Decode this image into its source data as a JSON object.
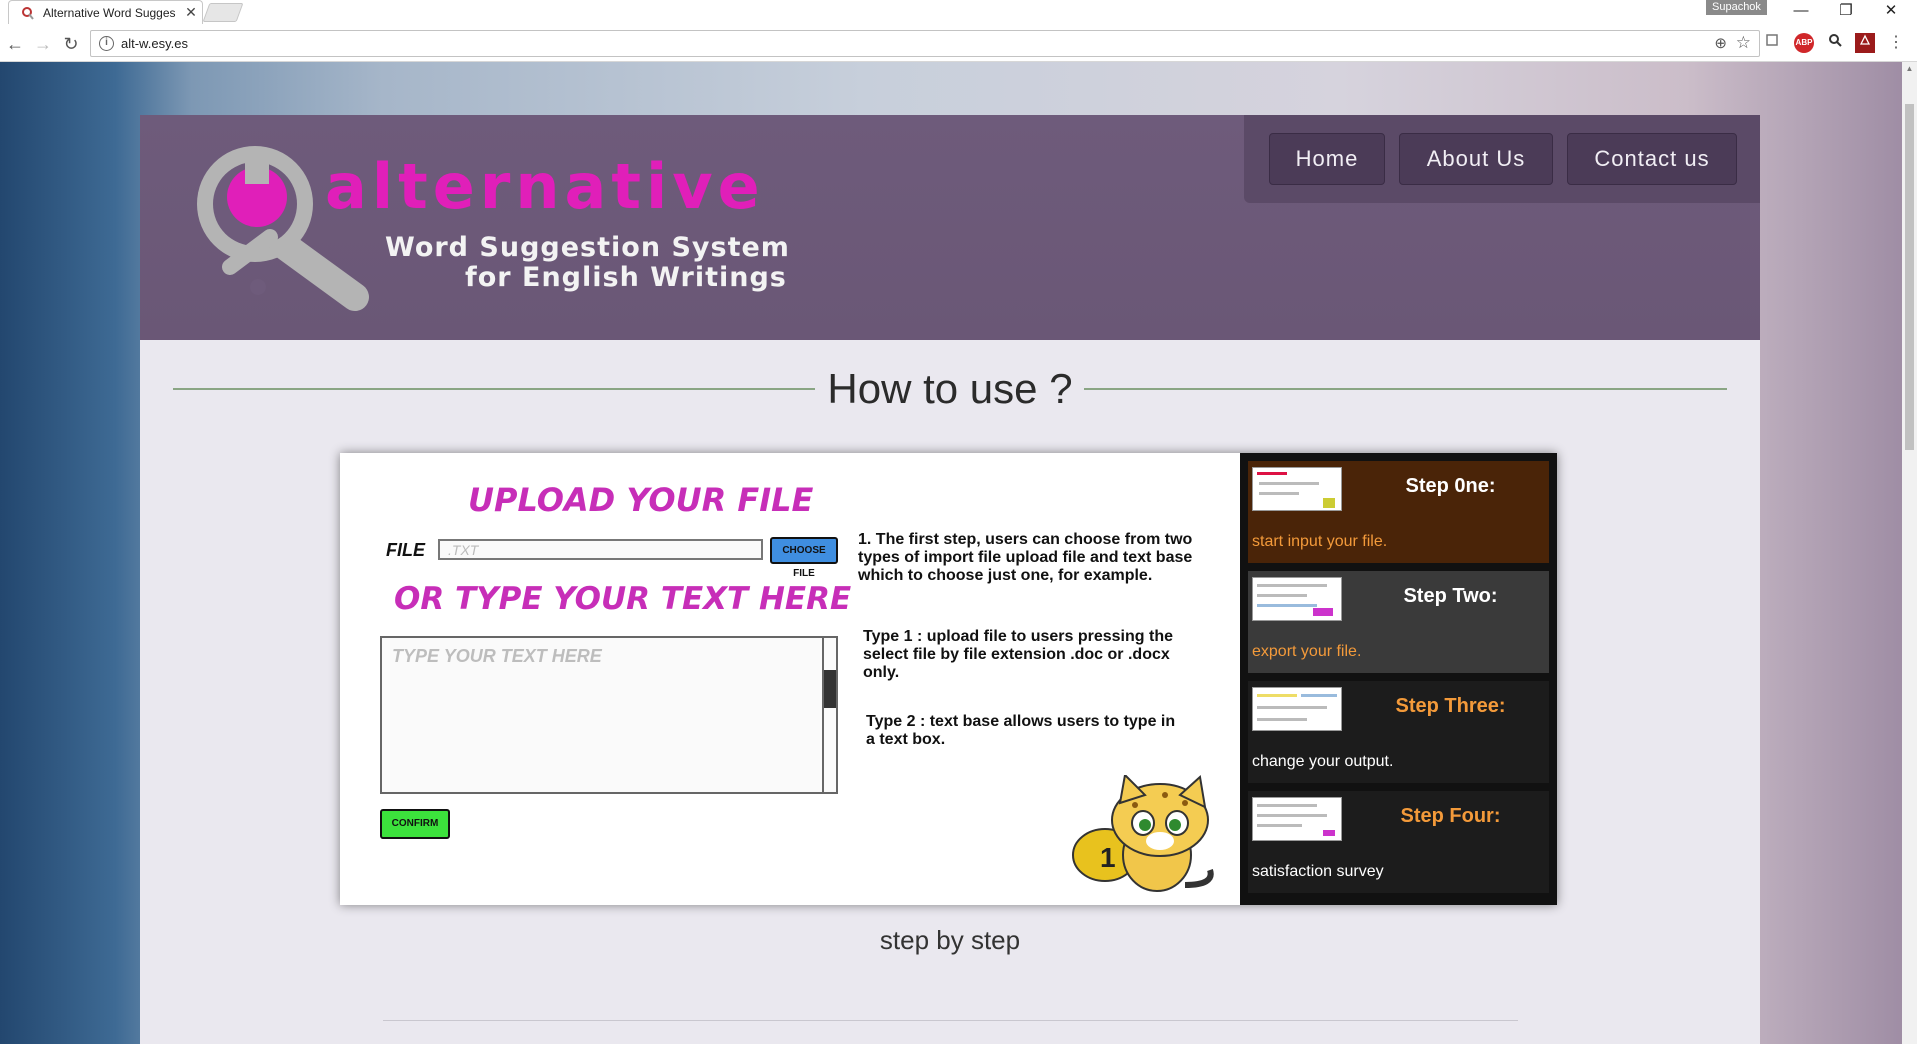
{
  "browser": {
    "tab_title": "Alternative Word Sugges",
    "tab_close": "✕",
    "user_badge": "Supachok",
    "url": "alt-w.esy.es",
    "abp_label": "ABP",
    "info_glyph": "i",
    "controls": {
      "minimize": "—",
      "restore": "❐",
      "close": "✕"
    },
    "nav": {
      "back": "←",
      "forward": "→",
      "reload": "↻"
    },
    "icons": [
      "favicon-icon",
      "info-icon",
      "zoom-icon",
      "star-icon",
      "cast-icon",
      "adblock-icon",
      "search-extension-icon",
      "pdf-icon",
      "menu-icon"
    ]
  },
  "header": {
    "logo_word": "alternative",
    "logo_line1": "Word Suggestion System",
    "logo_line2": "for English Writings",
    "nav": {
      "home": "Home",
      "about": "About Us",
      "contact": "Contact us"
    }
  },
  "section": {
    "title": "How to use ?",
    "caption": "step by step"
  },
  "slide": {
    "upload_title": "UPLOAD YOUR FILE",
    "file_label": "FILE",
    "file_placeholder": ".TXT",
    "choose_button": "CHOOSE FILE",
    "or_title": "OR TYPE YOUR TEXT HERE",
    "text_placeholder": "TYPE YOUR TEXT HERE",
    "confirm_button": "CONFIRM",
    "instruction_1": "1. The first step, users can choose from two types of import file upload file and text base which to choose just one, for example.",
    "instruction_2": "Type 1 : upload file to users pressing the select file by file extension .doc or .docx only.",
    "instruction_3": "Type 2 : text base allows users to type in a text box.",
    "badge_number": "1"
  },
  "steps": [
    {
      "title": "Step 0ne:",
      "desc": "start input your file."
    },
    {
      "title": "Step Two:",
      "desc": "export your file."
    },
    {
      "title": "Step Three:",
      "desc": "change your output."
    },
    {
      "title": "Step Four:",
      "desc": "satisfaction survey"
    }
  ],
  "colors": {
    "header_bg": "#6e5b7b",
    "logo_pink": "#e01fb9",
    "slide_pink": "#c72eb8",
    "active_step_bg": "#4a2408",
    "step_bg": "#3a3a3a",
    "accent_orange": "#f39a3a"
  }
}
